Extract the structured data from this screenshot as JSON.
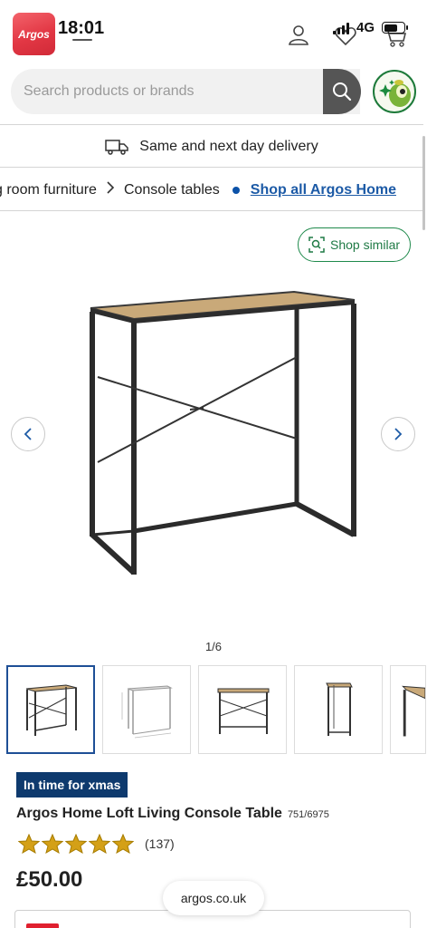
{
  "status_bar": {
    "time": "18:01",
    "network": "4G",
    "logo_text": "Argos"
  },
  "search": {
    "placeholder": "Search products or brands"
  },
  "delivery_banner": {
    "text": "Same and next day delivery"
  },
  "breadcrumb": {
    "items": [
      "g room furniture",
      "Console tables"
    ],
    "separator": ">",
    "shop_all_link": "Shop all Argos Home"
  },
  "gallery": {
    "shop_similar_label": "Shop similar",
    "pager": "1/6",
    "thumbnail_count": 5
  },
  "product": {
    "badge": "In time for xmas",
    "title": "Argos Home Loft Living Console Table",
    "catalogue_number": "751/6975",
    "rating_stars": 5,
    "review_count": "(137)",
    "price": "£50.00"
  },
  "browser": {
    "url": "argos.co.uk"
  },
  "colors": {
    "brand_red": "#e23744",
    "link_blue": "#1c5aa6",
    "badge_navy": "#0e3a6e",
    "star_gold": "#d4a017",
    "similar_green": "#1f8a4c"
  }
}
